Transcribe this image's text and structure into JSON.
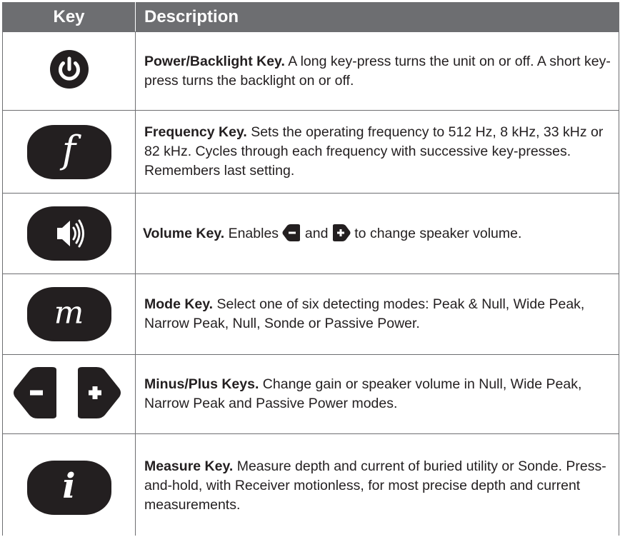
{
  "header": {
    "key": "Key",
    "description": "Description"
  },
  "rows": [
    {
      "key_icon": "power-icon",
      "title": "Power/Backlight Key.",
      "text": " A long key-press turns the unit on or off. A short key-press turns the backlight on or off."
    },
    {
      "key_icon": "frequency-key-icon",
      "key_letter": "f",
      "title": "Frequency Key.",
      "text": " Sets the operating frequency to 512 Hz, 8 kHz, 33 kHz or 82 kHz. Cycles through each frequency with successive key-presses. Remembers last setting."
    },
    {
      "key_icon": "volume-key-icon",
      "title": "Volume Key.",
      "text_1": " Enables ",
      "text_2": " and ",
      "text_3": " to change speaker volume."
    },
    {
      "key_icon": "mode-key-icon",
      "key_letter": "m",
      "title": "Mode Key.",
      "text": " Select one of six detecting modes: Peak & Null, Wide Peak, Narrow Peak, Null, Sonde or Passive Power."
    },
    {
      "key_icon": "minus-plus-keys-icon",
      "title": "Minus/Plus Keys.",
      "text": " Change gain or speaker volume in Null, Wide Peak, Narrow Peak and Passive Power modes."
    },
    {
      "key_icon": "measure-key-icon",
      "key_letter": "i",
      "title": "Measure Key.",
      "text": " Measure depth and current of buried utility or Sonde. Press-and-hold, with Receiver motionless, for most precise depth and current measurements."
    }
  ]
}
